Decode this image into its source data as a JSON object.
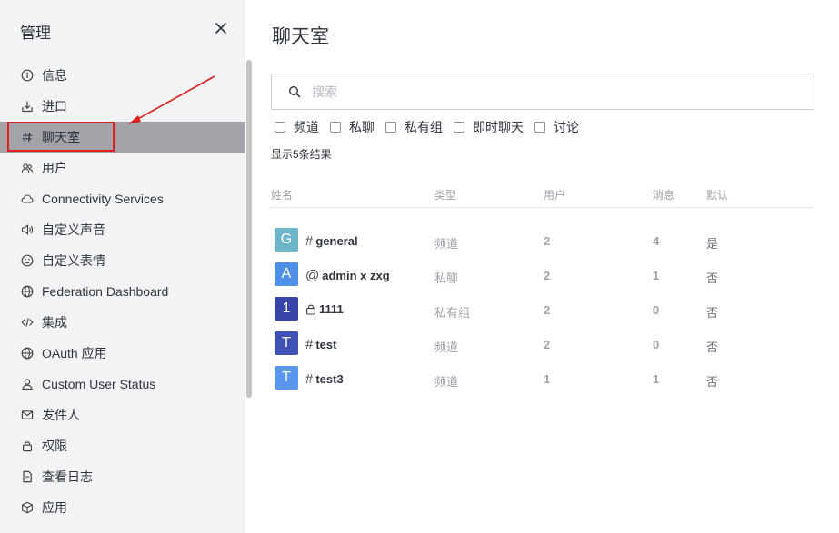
{
  "sidebar": {
    "title": "管理",
    "items": [
      {
        "label": "信息",
        "icon": "info-icon"
      },
      {
        "label": "进口",
        "icon": "import-icon"
      },
      {
        "label": "聊天室",
        "icon": "hashtag-icon",
        "active": true
      },
      {
        "label": "用户",
        "icon": "users-icon"
      },
      {
        "label": "Connectivity Services",
        "icon": "cloud-icon"
      },
      {
        "label": "自定义声音",
        "icon": "sound-icon"
      },
      {
        "label": "自定义表情",
        "icon": "emoji-icon"
      },
      {
        "label": "Federation Dashboard",
        "icon": "globe-icon"
      },
      {
        "label": "集成",
        "icon": "code-icon"
      },
      {
        "label": "OAuth 应用",
        "icon": "globe-icon"
      },
      {
        "label": "Custom User Status",
        "icon": "user-status-icon"
      },
      {
        "label": "发件人",
        "icon": "mail-icon"
      },
      {
        "label": "权限",
        "icon": "lock-icon"
      },
      {
        "label": "查看日志",
        "icon": "document-icon"
      },
      {
        "label": "应用",
        "icon": "cube-icon"
      }
    ]
  },
  "main": {
    "title": "聊天室",
    "search_placeholder": "搜索",
    "filters": [
      "频道",
      "私聊",
      "私有组",
      "即时聊天",
      "讨论"
    ],
    "result_count": "显示5条结果",
    "columns": [
      "姓名",
      "类型",
      "用户",
      "消息",
      "默认"
    ],
    "rows": [
      {
        "avatar": "G",
        "avatar_color": "#6fb5c9",
        "room_icon": "#",
        "name": "general",
        "type": "频道",
        "users": "2",
        "messages": "4",
        "default": "是"
      },
      {
        "avatar": "A",
        "avatar_color": "#4f8fe8",
        "room_icon": "@",
        "name": "admin x zxg",
        "type": "私聊",
        "users": "2",
        "messages": "1",
        "default": "否"
      },
      {
        "avatar": "1",
        "avatar_color": "#3745a8",
        "room_icon": "lock",
        "name": "1111",
        "type": "私有组",
        "users": "2",
        "messages": "0",
        "default": "否"
      },
      {
        "avatar": "T",
        "avatar_color": "#3f51b5",
        "room_icon": "#",
        "name": "test",
        "type": "频道",
        "users": "2",
        "messages": "0",
        "default": "否"
      },
      {
        "avatar": "T",
        "avatar_color": "#5a95ee",
        "room_icon": "#",
        "name": "test3",
        "type": "频道",
        "users": "1",
        "messages": "1",
        "default": "否"
      }
    ]
  },
  "colors": {
    "highlight": "#e0201b",
    "active_item": "#a1a3a8"
  }
}
